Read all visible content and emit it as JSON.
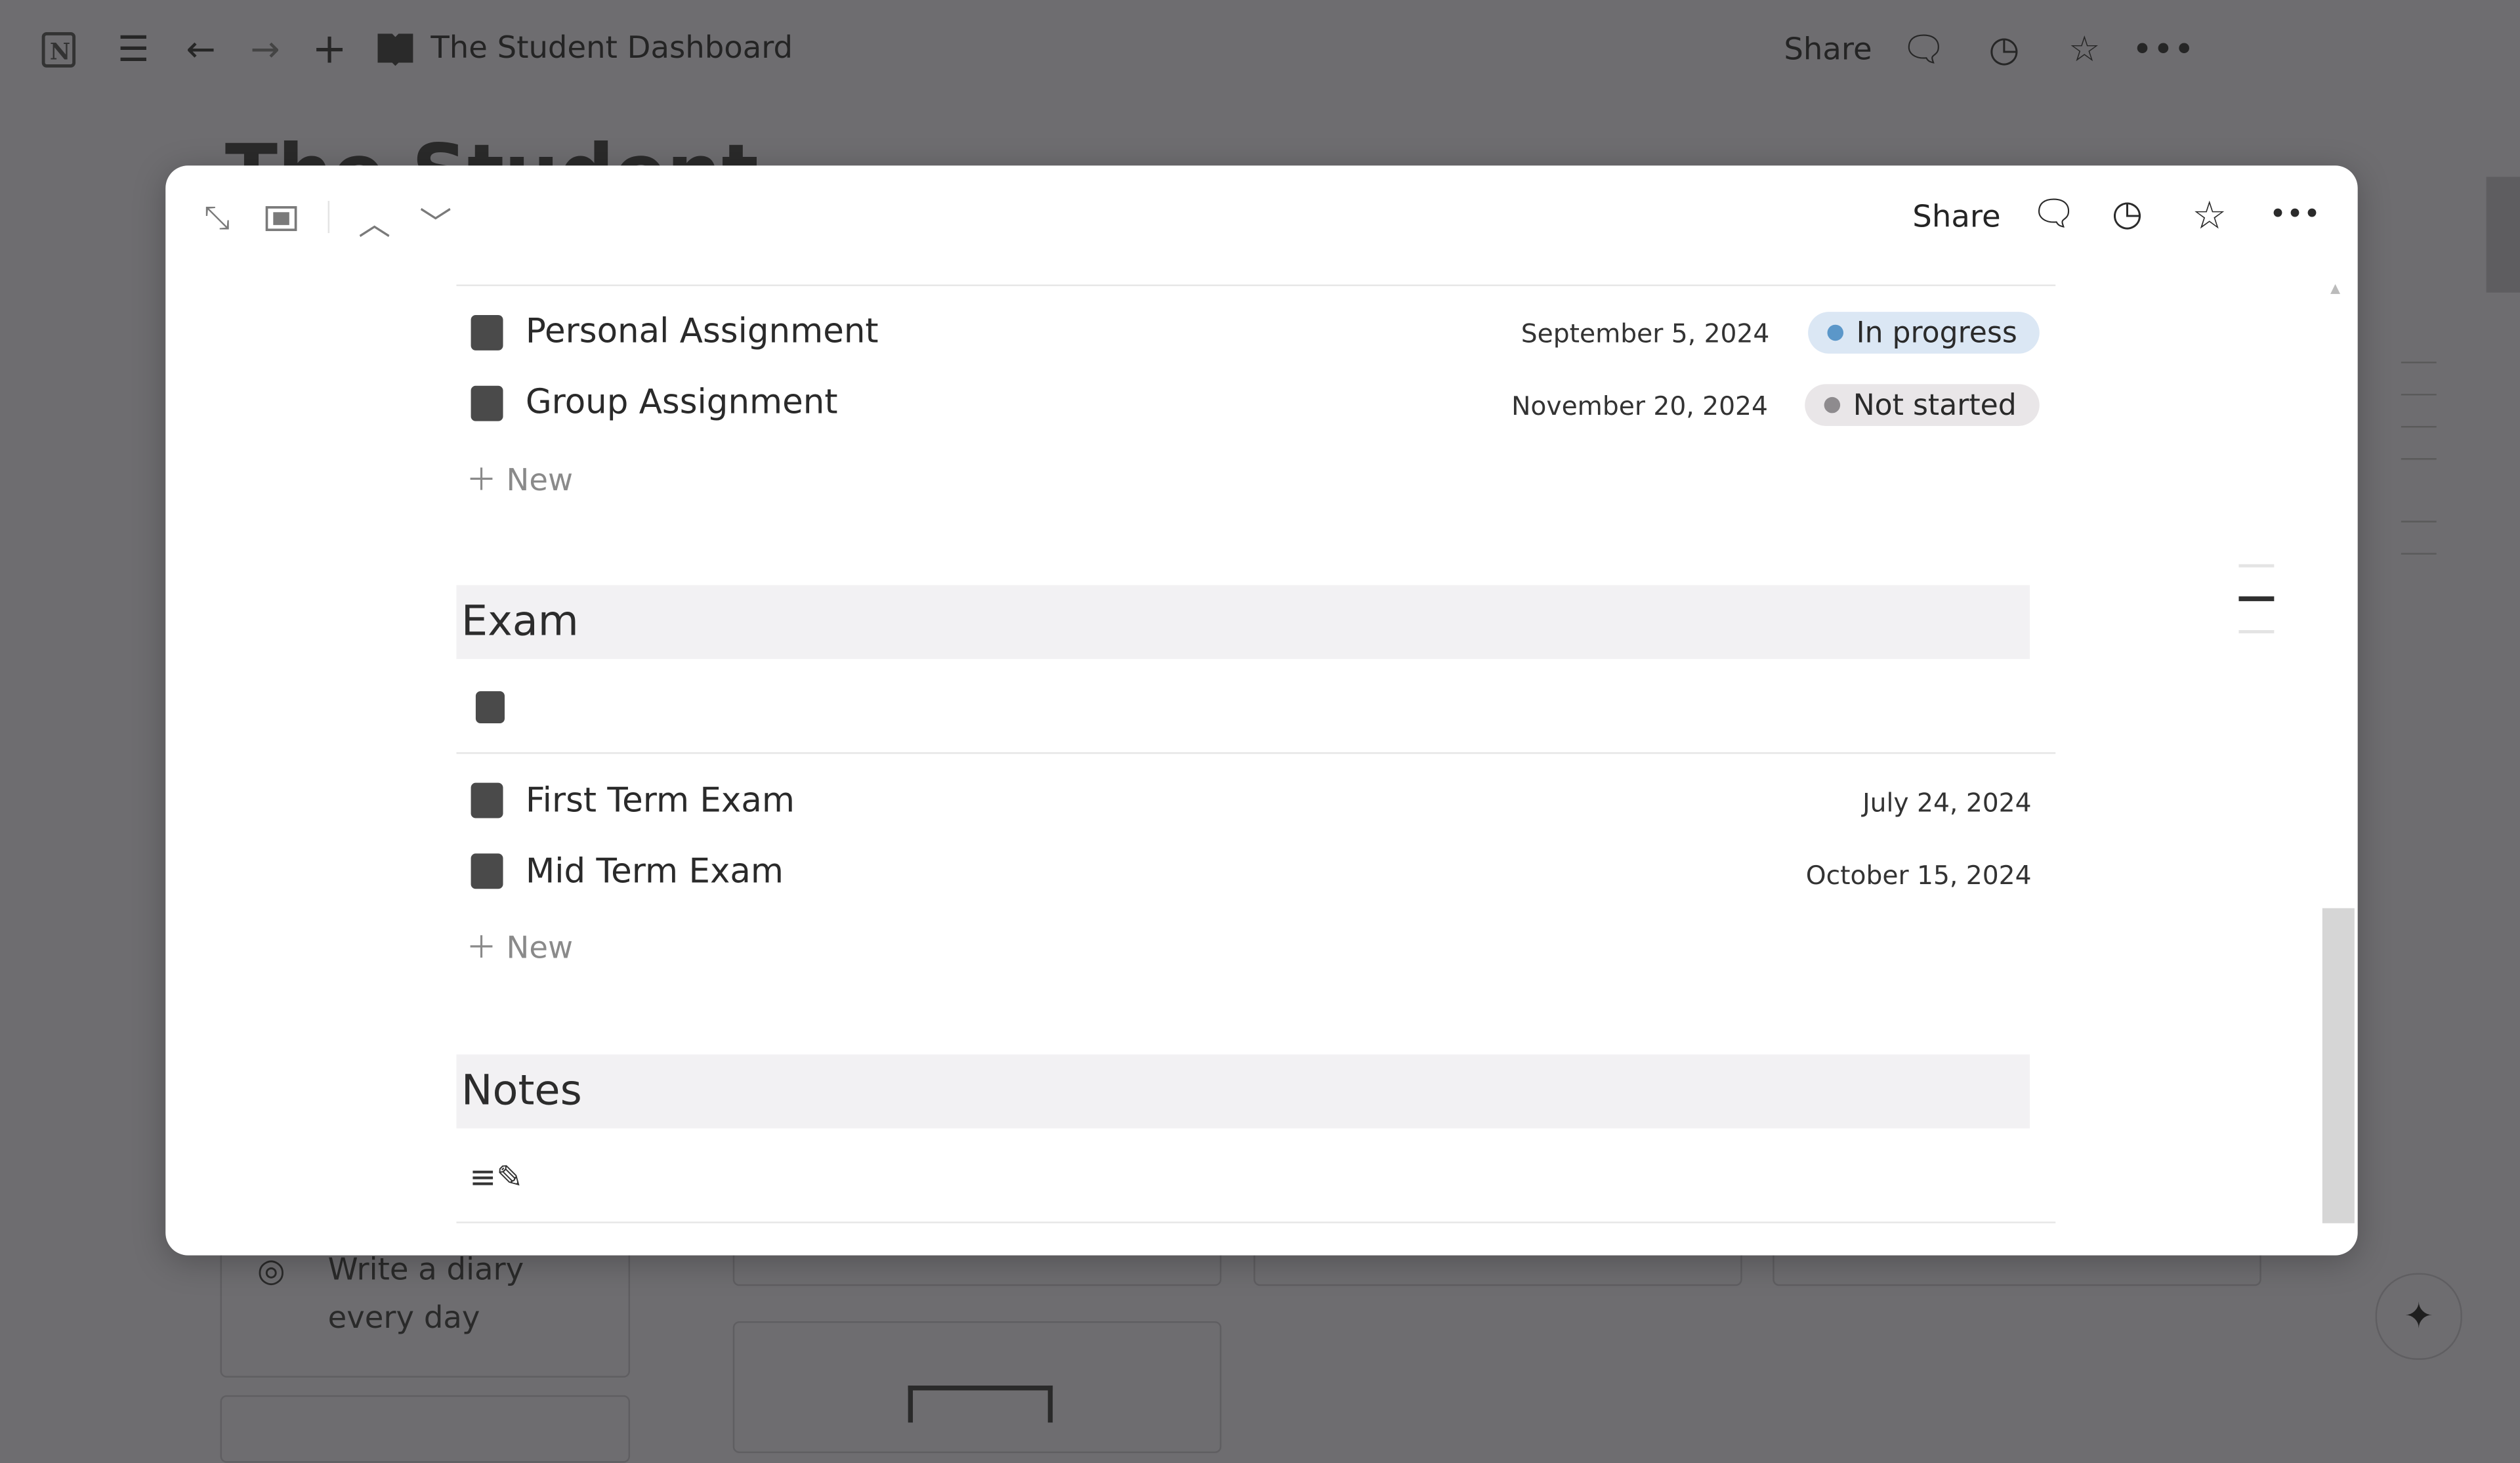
{
  "topbar": {
    "title": "The Student Dashboard",
    "share": "Share",
    "icons": [
      "notion-logo-icon",
      "menu-icon",
      "back-arrow-icon",
      "forward-arrow-icon",
      "plus-icon",
      "book-icon",
      "comment-icon",
      "clock-icon",
      "star-icon",
      "more-icon"
    ]
  },
  "background": {
    "page_title": "The Student Dashboard",
    "habit_card": "Write a diary every day"
  },
  "modal": {
    "share": "Share",
    "assignments": [
      {
        "title": "Personal Assignment",
        "date": "September 5, 2024",
        "status": "In progress",
        "status_color": "#5b97c9",
        "badge_bg": "#dbe7f4"
      },
      {
        "title": "Group Assignment",
        "date": "November 20, 2024",
        "status": "Not started",
        "status_color": "#8e8b8e",
        "badge_bg": "#e9e6e8"
      }
    ],
    "new_label": "New",
    "exam": {
      "heading": "Exam",
      "items": [
        {
          "title": "First Term Exam",
          "date": "July 24, 2024"
        },
        {
          "title": "Mid Term Exam",
          "date": "October 15, 2024"
        }
      ]
    },
    "notes": {
      "heading": "Notes"
    }
  }
}
